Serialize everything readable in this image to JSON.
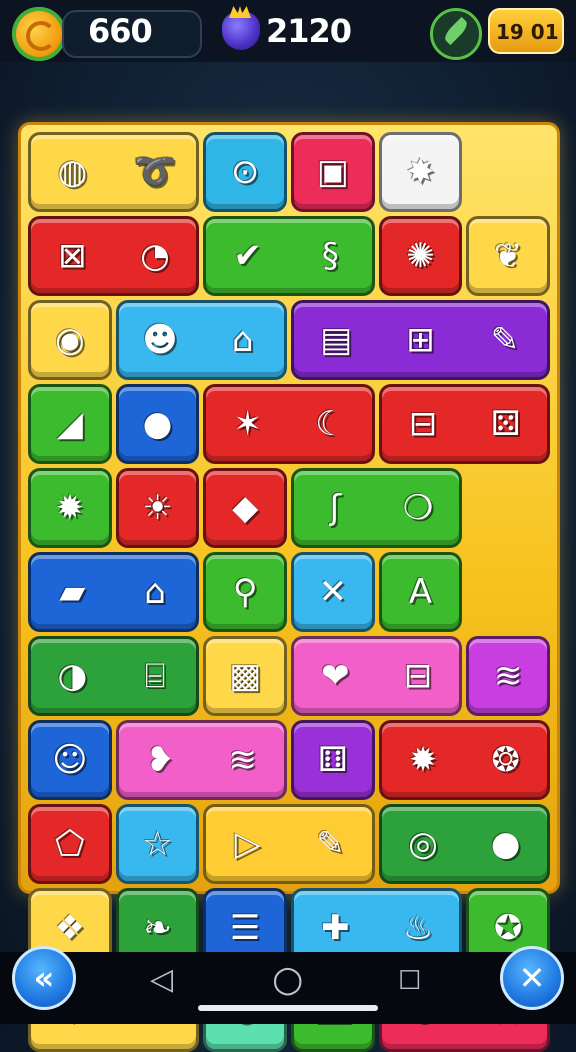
{
  "hud": {
    "coin_label": "660",
    "gem_label": "2120",
    "level_badge": "19 01"
  },
  "board": {
    "tiles": [
      {
        "w": 2,
        "color": "#ffd84a",
        "icons": [
          "◍",
          "➰"
        ]
      },
      {
        "w": 1,
        "color": "#2fb5e6",
        "icons": [
          "⊙"
        ]
      },
      {
        "w": 1,
        "color": "#ee2c5a",
        "icons": [
          "▣"
        ]
      },
      {
        "w": 1,
        "color": "#f4f4f4",
        "icons": [
          "✸"
        ]
      },
      {
        "w": 2,
        "color": "#e42828",
        "icons": [
          "⊠",
          "◔"
        ]
      },
      {
        "w": 2,
        "color": "#3dbb2e",
        "icons": [
          "✔",
          "§"
        ]
      },
      {
        "w": 1,
        "color": "#e42828",
        "icons": [
          "✺"
        ]
      },
      {
        "w": 1,
        "color": "#ffd84a",
        "icons": [
          "❦"
        ]
      },
      {
        "w": 1,
        "color": "#ffd84a",
        "icons": [
          "◉"
        ]
      },
      {
        "w": 2,
        "color": "#38b8ee",
        "icons": [
          "☻",
          "⌂"
        ]
      },
      {
        "w": 3,
        "color": "#8a2bd6",
        "icons": [
          "▤",
          "⊞",
          "✎"
        ]
      },
      {
        "w": 1,
        "color": "#3dbb2e",
        "icons": [
          "◢"
        ]
      },
      {
        "w": 1,
        "color": "#1e66d8",
        "icons": [
          "●"
        ]
      },
      {
        "w": 2,
        "color": "#e42828",
        "icons": [
          "✶",
          "☾"
        ]
      },
      {
        "w": 2,
        "color": "#e42828",
        "icons": [
          "⊟",
          "⚄"
        ]
      },
      {
        "w": 1,
        "color": "#3dbb2e",
        "icons": [
          "✹"
        ]
      },
      {
        "w": 1,
        "color": "#e42828",
        "icons": [
          "☀"
        ]
      },
      {
        "w": 1,
        "color": "#e42828",
        "icons": [
          "◆"
        ]
      },
      {
        "w": 2,
        "color": "#3dbb2e",
        "icons": [
          "ʃ",
          "❍"
        ]
      },
      {
        "w": 2,
        "color": "#1e66d8",
        "icons": [
          "▰",
          "⌂"
        ]
      },
      {
        "w": 1,
        "color": "#3dbb2e",
        "icons": [
          "⚲"
        ]
      },
      {
        "w": 1,
        "color": "#38b8ee",
        "icons": [
          "✕"
        ]
      },
      {
        "w": 1,
        "color": "#3dbb2e",
        "icons": [
          "A"
        ]
      },
      {
        "w": 2,
        "color": "#2da23a",
        "icons": [
          "◑",
          "⌸"
        ]
      },
      {
        "w": 1,
        "color": "#ffd84a",
        "icons": [
          "▩"
        ]
      },
      {
        "w": 2,
        "color": "#f25fc8",
        "icons": [
          "❤",
          "⊟"
        ]
      },
      {
        "w": 1,
        "color": "#c93ee0",
        "icons": [
          "≋"
        ]
      },
      {
        "w": 1,
        "color": "#1e66d8",
        "icons": [
          "☺"
        ]
      },
      {
        "w": 2,
        "color": "#f25fc8",
        "icons": [
          "❥",
          "≋"
        ]
      },
      {
        "w": 1,
        "color": "#9a30d8",
        "icons": [
          "⚅"
        ]
      },
      {
        "w": 2,
        "color": "#e42828",
        "icons": [
          "✹",
          "❂"
        ]
      },
      {
        "w": 1,
        "color": "#e42828",
        "icons": [
          "⬠"
        ]
      },
      {
        "w": 1,
        "color": "#38b8ee",
        "icons": [
          "☆"
        ]
      },
      {
        "w": 2,
        "color": "#ffcc33",
        "icons": [
          "▷",
          "✎"
        ]
      },
      {
        "w": 2,
        "color": "#2da23a",
        "icons": [
          "◎",
          "●"
        ]
      },
      {
        "w": 1,
        "color": "#ffd84a",
        "icons": [
          "❖"
        ]
      },
      {
        "w": 1,
        "color": "#2da23a",
        "icons": [
          "❧"
        ]
      },
      {
        "w": 1,
        "color": "#1e66d8",
        "icons": [
          "☰"
        ]
      },
      {
        "w": 2,
        "color": "#38b8ee",
        "icons": [
          "✚",
          "♨"
        ]
      },
      {
        "w": 1,
        "color": "#3dbb2e",
        "icons": [
          "✪"
        ]
      },
      {
        "w": 2,
        "color": "#ffd84a",
        "icons": [
          "♥",
          "✂"
        ]
      },
      {
        "w": 1,
        "color": "#5de0b0",
        "icons": [
          "⊚"
        ]
      },
      {
        "w": 1,
        "color": "#3dbb2e",
        "icons": [
          "⌧"
        ]
      },
      {
        "w": 2,
        "color": "#ee2c5a",
        "icons": [
          "∪",
          "★"
        ]
      }
    ]
  },
  "bottom": {
    "back_icon": "«",
    "close_icon": "✕",
    "nav_back": "◁",
    "nav_home": "○",
    "nav_recent": "☐"
  }
}
